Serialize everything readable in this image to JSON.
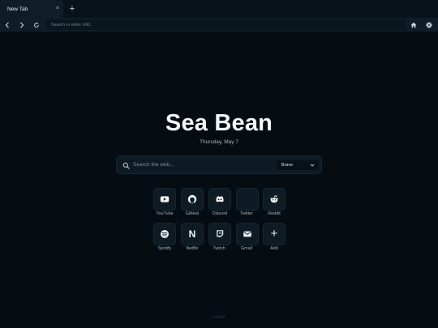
{
  "tabbar": {
    "tab_title": "New Tab",
    "close_glyph": "×",
    "new_tab_glyph": "+"
  },
  "navbar": {
    "back_icon": "chevron-left-icon",
    "forward_icon": "chevron-right-icon",
    "reload_icon": "reload-icon",
    "url_placeholder": "Search or enter URL",
    "home_icon": "home-icon",
    "settings_icon": "gear-icon"
  },
  "main": {
    "title": "Sea Bean",
    "date": "Thursday, May 7",
    "search": {
      "placeholder": "Search the web...",
      "engine": "Brave"
    },
    "shortcuts": [
      {
        "label": "YouTube",
        "icon": "youtube-icon"
      },
      {
        "label": "GitHub",
        "icon": "github-icon"
      },
      {
        "label": "Discord",
        "icon": "discord-icon"
      },
      {
        "label": "Twitter",
        "icon": "twitter-icon"
      },
      {
        "label": "Reddit",
        "icon": "reddit-icon"
      },
      {
        "label": "Spotify",
        "icon": "spotify-icon"
      },
      {
        "label": "Netflix",
        "icon": "netflix-icon",
        "glyph": "N"
      },
      {
        "label": "Twitch",
        "icon": "twitch-icon"
      },
      {
        "label": "Gmail",
        "icon": "mail-icon"
      },
      {
        "label": "Add",
        "icon": "plus-icon",
        "glyph": "+"
      }
    ]
  },
  "footer": {
    "text": "sn·tuff"
  },
  "colors": {
    "background": "#050d13",
    "surface": "#0e1b24",
    "toolbar": "#0f1d26",
    "text": "#e8edf1"
  }
}
